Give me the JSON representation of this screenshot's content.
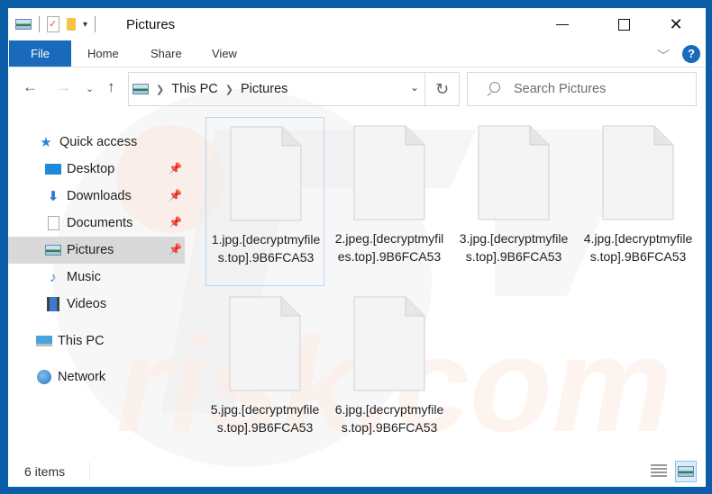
{
  "window": {
    "title": "Pictures",
    "controls": {
      "minimize": "minimize",
      "maximize": "maximize",
      "close": "close"
    }
  },
  "quick_access_toolbar": {
    "icons": [
      "pictures-icon",
      "properties-icon",
      "new-folder-icon",
      "customize-dropdown-icon"
    ]
  },
  "ribbon": {
    "tabs": [
      {
        "label": "File",
        "active": true
      },
      {
        "label": "Home"
      },
      {
        "label": "Share"
      },
      {
        "label": "View"
      }
    ],
    "help_label": "?"
  },
  "navigation": {
    "breadcrumb": [
      "This PC",
      "Pictures"
    ],
    "search_placeholder": "Search Pictures"
  },
  "sidebar": {
    "items": [
      {
        "label": "Quick access",
        "icon": "star-icon"
      },
      {
        "label": "Desktop",
        "icon": "desktop-icon",
        "pinned": true
      },
      {
        "label": "Downloads",
        "icon": "downloads-icon",
        "pinned": true
      },
      {
        "label": "Documents",
        "icon": "documents-icon",
        "pinned": true
      },
      {
        "label": "Pictures",
        "icon": "pictures-icon",
        "pinned": true,
        "selected": true
      },
      {
        "label": "Music",
        "icon": "music-icon"
      },
      {
        "label": "Videos",
        "icon": "videos-icon"
      },
      {
        "label": "This PC",
        "icon": "this-pc-icon"
      },
      {
        "label": "Network",
        "icon": "network-icon"
      }
    ]
  },
  "files": [
    {
      "name": "1.jpg.[decryptmyfiles.top].9B6FCA53",
      "selected": true
    },
    {
      "name": "2.jpeg.[decryptmyfiles.top].9B6FCA53"
    },
    {
      "name": "3.jpg.[decryptmyfiles.top].9B6FCA53"
    },
    {
      "name": "4.jpg.[decryptmyfiles.top].9B6FCA53"
    },
    {
      "name": "5.jpg.[decryptmyfiles.top].9B6FCA53"
    },
    {
      "name": "6.jpg.[decryptmyfiles.top].9B6FCA53"
    }
  ],
  "status": {
    "item_count": "6 items"
  },
  "colors": {
    "accent": "#1a6abb",
    "frame": "#0b5da8",
    "selected_bg": "#d9d9d9"
  }
}
